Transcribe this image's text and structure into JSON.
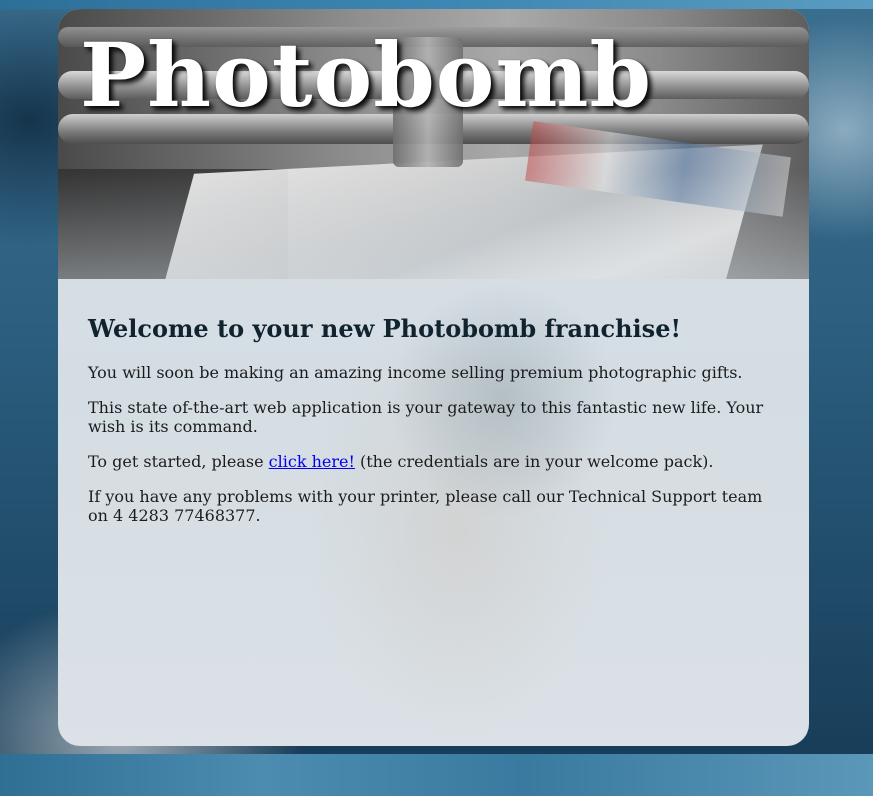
{
  "header": {
    "title": "Photobomb"
  },
  "main": {
    "heading": "Welcome to your new Photobomb franchise!",
    "paragraph_1": "You will soon be making an amazing income selling premium photographic gifts.",
    "paragraph_2": "This state of-the-art web application is your gateway to this fantastic new life. Your wish is its command.",
    "paragraph_3_before_link": "To get started, please ",
    "paragraph_3_link": "click here!",
    "paragraph_3_after_link": " (the credentials are in your welcome pack).",
    "paragraph_4": "If you have any problems with your printer, please call our Technical Support team on 4 4283 77468377."
  }
}
